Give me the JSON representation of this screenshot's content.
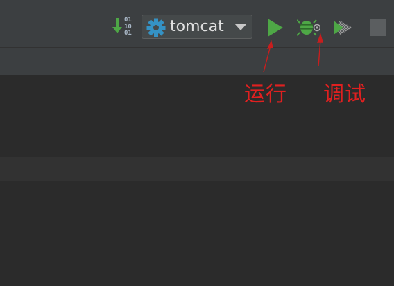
{
  "toolbar": {
    "binary_icon_text": "01\n10\n01",
    "run_config": {
      "name": "tomcat",
      "icon": "gear-icon"
    },
    "buttons": {
      "run": "play-icon",
      "debug": "bug-icon",
      "coverage": "coverage-icon",
      "stop": "stop-icon"
    }
  },
  "annotations": {
    "run_label": "运行",
    "debug_label": "调试"
  },
  "colors": {
    "run_green": "#4ea746",
    "gear_blue": "#3592c4",
    "annotation_red": "#e02020"
  }
}
